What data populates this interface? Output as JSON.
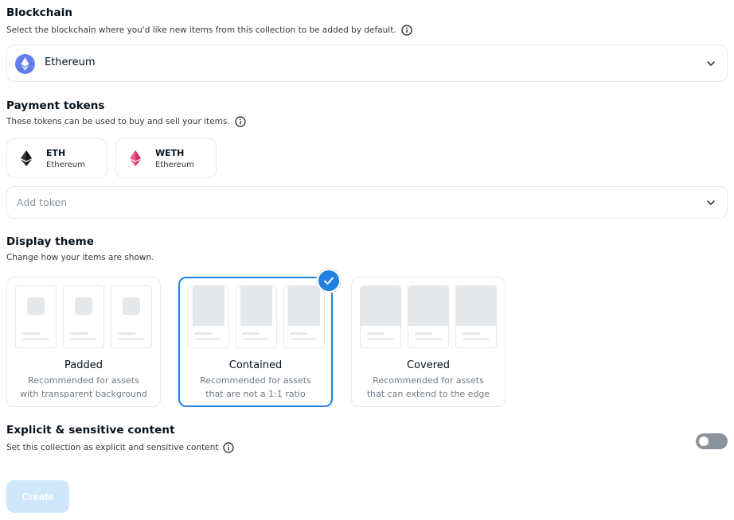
{
  "blockchain": {
    "title": "Blockchain",
    "description": "Select the blockchain where you'd like new items from this collection to be added by default.",
    "selected": "Ethereum",
    "icon": "ethereum-icon"
  },
  "payment_tokens": {
    "title": "Payment tokens",
    "description": "These tokens can be used to buy and sell your items.",
    "tokens": [
      {
        "symbol": "ETH",
        "chain": "Ethereum",
        "icon": "eth-icon"
      },
      {
        "symbol": "WETH",
        "chain": "Ethereum",
        "icon": "weth-icon"
      }
    ],
    "add_token_placeholder": "Add token"
  },
  "display_theme": {
    "title": "Display theme",
    "description": "Change how your items are shown.",
    "options": [
      {
        "name": "Padded",
        "desc_line1": "Recommended for assets",
        "desc_line2": "with transparent background",
        "selected": false
      },
      {
        "name": "Contained",
        "desc_line1": "Recommended for assets",
        "desc_line2": "that are not a 1:1 ratio",
        "selected": true
      },
      {
        "name": "Covered",
        "desc_line1": "Recommended for assets",
        "desc_line2": "that can extend to the edge",
        "selected": false
      }
    ]
  },
  "explicit": {
    "title": "Explicit & sensitive content",
    "description": "Set this collection as explicit and sensitive content",
    "enabled": false
  },
  "create_label": "Create",
  "colors": {
    "accent": "#2081e2",
    "border": "#e5e8eb",
    "text": "#04111d",
    "muted": "#707a83",
    "create_disabled": "#cfe6fb",
    "toggle_off": "#8a939b"
  }
}
